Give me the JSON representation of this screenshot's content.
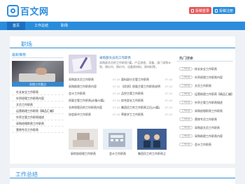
{
  "header": {
    "logo_text": "百文网",
    "login_label": "投稿登录",
    "register_label": "投稿注册"
  },
  "nav": {
    "items": [
      "首页",
      "工作总结",
      "职场"
    ]
  },
  "section": {
    "title": "职场",
    "subtitle": "最新推荐"
  },
  "featured": {
    "caption": "实践工作要点"
  },
  "left_list": [
    "社长安全工作职责",
    "外贸经理工作职责内容",
    "文员工作职责",
    "运营助理工作职责【精品汇编】",
    "外贸主管工作职责描述",
    "采购经理职责工作职责",
    "营销专员工作职责"
  ],
  "top_article": {
    "title": "采购部文员的工作职责",
    "desc": "采购部文员的工作职责7篇，产品流程、设备、部门采购计划、原价内、原价内、设备原材料、原材料等。"
  },
  "articles": [
    {
      "a": "采购部文员工作职责",
      "ad": "07-10",
      "b": "面料部分主管工作职责",
      "bd": "07-10"
    },
    {
      "a": "采购助理工作职责内容",
      "ad": "07-10",
      "b": "【优质】质量主管工作职责说明",
      "bd": "07-10"
    },
    {
      "a": "会计工作职责",
      "ad": "07-10",
      "b": "品控主管工作职责",
      "bd": "07-10"
    },
    {
      "a": "质量主管工作职责(必备32篇)",
      "ad": "07-10",
      "b": "综合部长工作职责",
      "bd": "07-10"
    },
    {
      "a": "仓库保管员的工作职责内容",
      "ad": "07-10",
      "b": "集团员工的工作职责之后(14篇)",
      "bd": "07-10"
    },
    {
      "a": "协会秘书工作职责",
      "ad": "07-10",
      "b": "草胶学工工作职责",
      "bd": "07-10"
    }
  ],
  "thumbs": [
    "厨房部经理工作职责",
    "会计工作职责",
    "集团员工的工作职责之"
  ],
  "hot": {
    "title": "热门搜索",
    "tag_label": "工作职责",
    "items": [
      "校长安全工作职责",
      "外贸经理工作职责内容",
      "文员工作职责",
      "运营助理工作职责【精品汇编】",
      "外贸主管工作职责描述",
      "采购经理职责工作职责",
      "营销专员工作职责",
      "采购部文员工作职责",
      "采购助理工作职责内容",
      "会计工作职责"
    ]
  },
  "section2": {
    "title": "工作总结"
  }
}
